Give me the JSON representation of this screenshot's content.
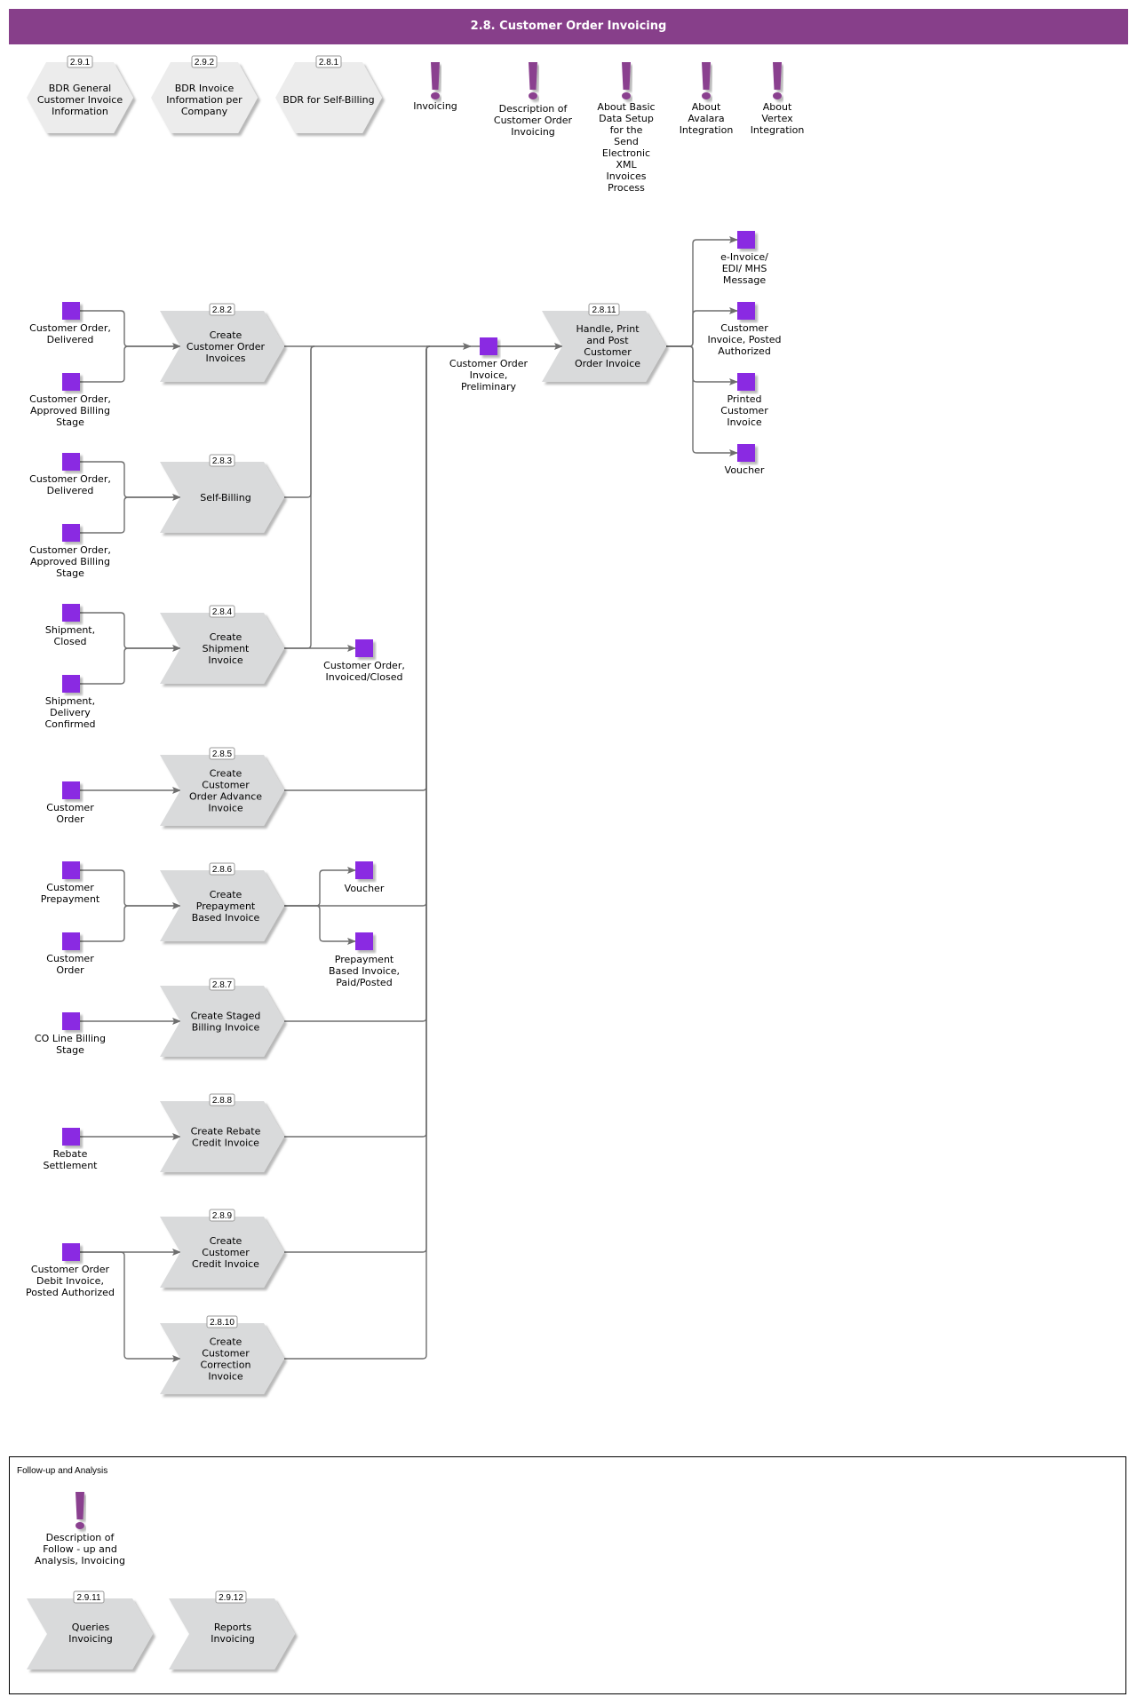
{
  "header": {
    "title": "2.8. Customer Order Invoicing"
  },
  "colors": {
    "header_bg": "#873f8a",
    "event": "#8a2be2",
    "function_fill": "#d9dadb",
    "bdr_fill": "#ececec",
    "info_icon": "#8a3f8f",
    "connector": "#6e6e6e"
  },
  "top_bdr": [
    {
      "id": "2.9.1",
      "label": "BDR General Customer Invoice Information",
      "lines": [
        "BDR General",
        "Customer Invoice",
        "Information"
      ]
    },
    {
      "id": "2.9.2",
      "label": "BDR Invoice Information per Company",
      "lines": [
        "BDR Invoice",
        "Information per",
        "Company"
      ]
    },
    {
      "id": "2.8.1",
      "label": "BDR for Self-Billing",
      "lines": [
        "BDR for Self-Billing"
      ]
    }
  ],
  "top_info": [
    {
      "label": "Invoicing",
      "lines": [
        "Invoicing"
      ],
      "icon": "exclamation-icon"
    },
    {
      "label": "Description of Customer Order Invoicing",
      "lines": [
        "Description of",
        "Customer Order",
        "Invoicing"
      ],
      "icon": "exclamation-icon"
    },
    {
      "label": "About Basic Data Setup for the Send Electronic XML Invoices Process",
      "lines": [
        "About Basic",
        "Data Setup",
        "for the",
        "Send",
        "Electronic",
        "XML",
        "Invoices",
        "Process"
      ],
      "icon": "exclamation-icon"
    },
    {
      "label": "About Avalara Integration",
      "lines": [
        "About",
        "Avalara",
        "Integration"
      ],
      "icon": "exclamation-icon"
    },
    {
      "label": "About Vertex Integration",
      "lines": [
        "About",
        "Vertex",
        "Integration"
      ],
      "icon": "exclamation-icon"
    }
  ],
  "functions": [
    {
      "id": "2.8.2",
      "lines": [
        "Create",
        "Customer Order",
        "Invoices"
      ],
      "inputs": [
        {
          "lines": [
            "Customer Order,",
            "Delivered"
          ]
        },
        {
          "lines": [
            "Customer Order,",
            "Approved Billing",
            "Stage"
          ]
        }
      ],
      "outputs": []
    },
    {
      "id": "2.8.3",
      "lines": [
        "Self-Billing"
      ],
      "inputs": [
        {
          "lines": [
            "Customer Order,",
            "Delivered"
          ]
        },
        {
          "lines": [
            "Customer Order,",
            "Approved Billing",
            "Stage"
          ]
        }
      ],
      "outputs": []
    },
    {
      "id": "2.8.4",
      "lines": [
        "Create",
        "Shipment",
        "Invoice"
      ],
      "inputs": [
        {
          "lines": [
            "Shipment,",
            "Closed"
          ]
        },
        {
          "lines": [
            "Shipment,",
            "Delivery",
            "Confirmed"
          ]
        }
      ],
      "outputs": [
        {
          "lines": [
            "Customer Order,",
            "Invoiced/Closed"
          ]
        }
      ]
    },
    {
      "id": "2.8.5",
      "lines": [
        "Create",
        "Customer",
        "Order Advance",
        "Invoice"
      ],
      "inputs": [
        {
          "lines": [
            "Customer",
            "Order"
          ]
        }
      ],
      "outputs": []
    },
    {
      "id": "2.8.6",
      "lines": [
        "Create",
        "Prepayment",
        "Based Invoice"
      ],
      "inputs": [
        {
          "lines": [
            "Customer",
            "Prepayment"
          ]
        },
        {
          "lines": [
            "Customer",
            "Order"
          ]
        }
      ],
      "outputs": [
        {
          "lines": [
            "Voucher"
          ]
        },
        {
          "lines": [
            "Prepayment",
            "Based Invoice,",
            "Paid/Posted"
          ]
        }
      ]
    },
    {
      "id": "2.8.7",
      "lines": [
        "Create Staged",
        "Billing Invoice"
      ],
      "inputs": [
        {
          "lines": [
            "CO Line Billing",
            "Stage"
          ]
        }
      ],
      "outputs": []
    },
    {
      "id": "2.8.8",
      "lines": [
        "Create Rebate",
        "Credit Invoice"
      ],
      "inputs": [
        {
          "lines": [
            "Rebate",
            "Settlement"
          ]
        }
      ],
      "outputs": []
    },
    {
      "id": "2.8.9",
      "lines": [
        "Create",
        "Customer",
        "Credit Invoice"
      ],
      "inputs": [
        {
          "lines": [
            "Customer Order",
            "Debit Invoice,",
            "Posted Authorized"
          ]
        }
      ],
      "outputs": []
    },
    {
      "id": "2.8.10",
      "lines": [
        "Create",
        "Customer",
        "Correction",
        "Invoice"
      ],
      "inputs": [],
      "outputs": []
    }
  ],
  "merge_event": {
    "lines": [
      "Customer Order",
      "Invoice,",
      "Preliminary"
    ]
  },
  "final_function": {
    "id": "2.8.11",
    "lines": [
      "Handle, Print",
      "and Post",
      "Customer",
      "Order Invoice"
    ],
    "outputs": [
      {
        "lines": [
          "e-Invoice/",
          "EDI/ MHS",
          "Message"
        ]
      },
      {
        "lines": [
          "Customer",
          "Invoice, Posted",
          "Authorized"
        ]
      },
      {
        "lines": [
          "Printed",
          "Customer",
          "Invoice"
        ]
      },
      {
        "lines": [
          "Voucher"
        ]
      }
    ]
  },
  "followup": {
    "title": "Follow-up and Analysis",
    "info": {
      "lines": [
        "Description of",
        "Follow - up and",
        "Analysis, Invoicing"
      ]
    },
    "functions": [
      {
        "id": "2.9.11",
        "lines": [
          "Queries",
          "Invoicing"
        ]
      },
      {
        "id": "2.9.12",
        "lines": [
          "Reports",
          "Invoicing"
        ]
      }
    ]
  }
}
